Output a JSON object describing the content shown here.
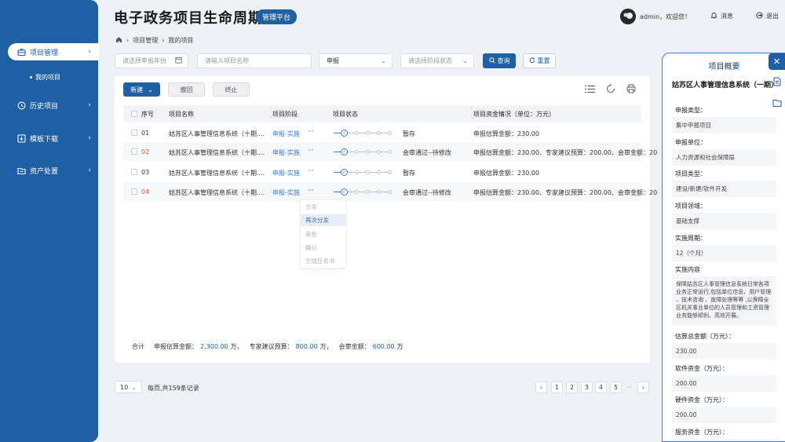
{
  "app": {
    "title": "电子政务项目生命周期",
    "badge": "管理平台"
  },
  "header": {
    "user": "admin，欢迎您！",
    "messages": "消息",
    "logout": "退出"
  },
  "sidebar": {
    "items": [
      {
        "label": "项目管理",
        "icon": "briefcase-icon"
      },
      {
        "label": "历史项目",
        "icon": "clock-icon"
      },
      {
        "label": "模板下载",
        "icon": "download-icon"
      },
      {
        "label": "资产处置",
        "icon": "folder-icon"
      }
    ],
    "subitem": "我的项目"
  },
  "breadcrumb": [
    "项目管理",
    "我的项目"
  ],
  "filters": {
    "year_placeholder": "请选择申报年份",
    "name_placeholder": "请输入项目名称",
    "stage_value": "申报",
    "status_placeholder": "请选择阶段状态",
    "search_label": "查询",
    "reset_label": "重置"
  },
  "toolbar": {
    "new_label": "新建",
    "withdraw_label": "撤回",
    "terminate_label": "终止"
  },
  "table": {
    "headers": [
      "序号",
      "项目名称",
      "项目阶段",
      "项目状态",
      "项目资金情况（单位：万元）"
    ],
    "rows": [
      {
        "no": "01",
        "name": "姑苏区人事管理信息系统（十期....",
        "stage_a": "申报",
        "stage_b": "实施",
        "status": "暂存",
        "funds": "申报估算金额：230.00"
      },
      {
        "no": "02",
        "name": "姑苏区人事管理信息系统（十期....",
        "stage_a": "申报",
        "stage_b": "实施",
        "status": "会审通过--待修改",
        "funds": "申报估算金额：230.00、专家建议预算：200.00、会审金额：20"
      },
      {
        "no": "03",
        "name": "姑苏区人事管理信息系统（十期....",
        "stage_a": "申报",
        "stage_b": "实施",
        "status": "暂存",
        "funds": "申报估算金额：230.00"
      },
      {
        "no": "04",
        "name": "姑苏区人事管理信息系统（十期....",
        "stage_a": "申报",
        "stage_b": "实施",
        "status": "会审通过--待修改",
        "funds": "申报估算金额：230.00、专家建议预算：200.00、会审金额：20"
      }
    ],
    "more": "···",
    "progress_check": "✓"
  },
  "dropdown": [
    "分发",
    "再次分发",
    "审批",
    "确认",
    "生成任务书"
  ],
  "summary": {
    "label": "合计",
    "est_label": "申报估算金额：",
    "est_value": "2,300.00",
    "est_unit": "万，",
    "expert_label": "专家建议预算：",
    "expert_value": "800.00",
    "expert_unit": "万，",
    "review_label": "会审金额：",
    "review_value": "600.00",
    "review_unit": "万"
  },
  "pagination": {
    "page_size": "10",
    "info": "每页,共159条记录",
    "pages": [
      "1",
      "2",
      "3",
      "4",
      "5"
    ],
    "ellipsis": "···"
  },
  "panel": {
    "title": "项目概要",
    "name": "姑苏区人事管理信息系统（一期）",
    "fields": [
      {
        "label": "申报类型：",
        "value": "集中申报项目"
      },
      {
        "label": "申报单位：",
        "value": "人力资源和社会保障局"
      },
      {
        "label": "项目类型：",
        "value": "建设/新建/软件开发"
      },
      {
        "label": "项目领域：",
        "value": "基础支撑"
      },
      {
        "label": "实施周期：",
        "value": "12（个月）"
      },
      {
        "label": "实施内容",
        "value": "保障姑苏区人事管理信息系统日常各项业务正常运行,包括单位信息、用户管理 、技术咨询 、故障处理等等 ,以保障全区机关事业单位的人员管理和工资管理业务能够顺利、高效开展。"
      },
      {
        "label": "估算总金额（万元）：",
        "value": "230.00"
      },
      {
        "label": "软件资金（万元）：",
        "value": "200.00"
      },
      {
        "label": "硬件资金（万元）：",
        "value": "200.00"
      },
      {
        "label": "服务资金（万元）：",
        "value": ""
      }
    ]
  },
  "colors": {
    "primary": "#1f5fa4",
    "link": "#3a7bd5",
    "danger": "#e05a2b"
  }
}
